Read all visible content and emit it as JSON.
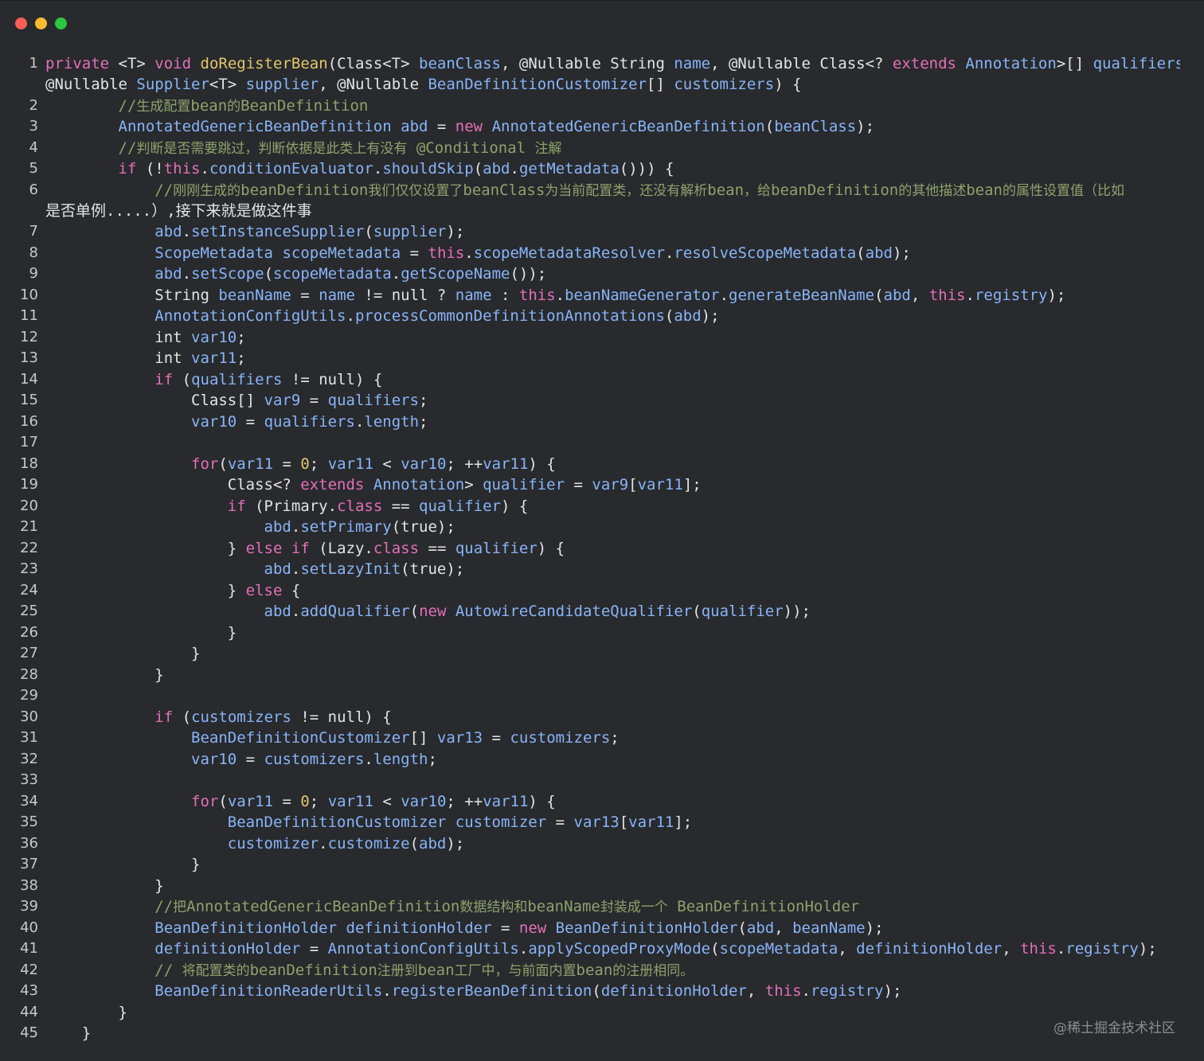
{
  "window": {
    "buttons": [
      {
        "name": "close",
        "color": "#fe5f57"
      },
      {
        "name": "minimize",
        "color": "#febc2e"
      },
      {
        "name": "zoom",
        "color": "#28c840"
      }
    ]
  },
  "watermark": "@稀土掘金技术社区",
  "colors": {
    "background": "#282a2d",
    "keyword": "#e46fb9",
    "function": "#e2c76b",
    "identifier": "#89b4f8",
    "comment": "#8fa26c",
    "plain": "#e4e4e4"
  },
  "code": {
    "lines": [
      {
        "n": "1",
        "text": "private <T> void doRegisterBean(Class<T> beanClass, @Nullable String name, @Nullable Class<? extends Annotation>[] qualifiers,",
        "cont": "@Nullable Supplier<T> supplier, @Nullable BeanDefinitionCustomizer[] customizers) {"
      },
      {
        "n": "2",
        "text": "        //生成配置bean的BeanDefinition"
      },
      {
        "n": "3",
        "text": "        AnnotatedGenericBeanDefinition abd = new AnnotatedGenericBeanDefinition(beanClass);"
      },
      {
        "n": "4",
        "text": "        //判断是否需要跳过，判断依据是此类上有没有 @Conditional 注解"
      },
      {
        "n": "5",
        "text": "        if (!this.conditionEvaluator.shouldSkip(abd.getMetadata())) {"
      },
      {
        "n": "6",
        "text": "            //刚刚生成的beanDefinition我们仅仅设置了beanClass为当前配置类，还没有解析bean，给beanDefinition的其他描述bean的属性设置值（比如",
        "cont": "是否单例.....）,接下来就是做这件事"
      },
      {
        "n": "7",
        "text": "            abd.setInstanceSupplier(supplier);"
      },
      {
        "n": "8",
        "text": "            ScopeMetadata scopeMetadata = this.scopeMetadataResolver.resolveScopeMetadata(abd);"
      },
      {
        "n": "9",
        "text": "            abd.setScope(scopeMetadata.getScopeName());"
      },
      {
        "n": "10",
        "text": "            String beanName = name != null ? name : this.beanNameGenerator.generateBeanName(abd, this.registry);"
      },
      {
        "n": "11",
        "text": "            AnnotationConfigUtils.processCommonDefinitionAnnotations(abd);"
      },
      {
        "n": "12",
        "text": "            int var10;"
      },
      {
        "n": "13",
        "text": "            int var11;"
      },
      {
        "n": "14",
        "text": "            if (qualifiers != null) {"
      },
      {
        "n": "15",
        "text": "                Class[] var9 = qualifiers;"
      },
      {
        "n": "16",
        "text": "                var10 = qualifiers.length;"
      },
      {
        "n": "17",
        "text": ""
      },
      {
        "n": "18",
        "text": "                for(var11 = 0; var11 < var10; ++var11) {"
      },
      {
        "n": "19",
        "text": "                    Class<? extends Annotation> qualifier = var9[var11];"
      },
      {
        "n": "20",
        "text": "                    if (Primary.class == qualifier) {"
      },
      {
        "n": "21",
        "text": "                        abd.setPrimary(true);"
      },
      {
        "n": "22",
        "text": "                    } else if (Lazy.class == qualifier) {"
      },
      {
        "n": "23",
        "text": "                        abd.setLazyInit(true);"
      },
      {
        "n": "24",
        "text": "                    } else {"
      },
      {
        "n": "25",
        "text": "                        abd.addQualifier(new AutowireCandidateQualifier(qualifier));"
      },
      {
        "n": "26",
        "text": "                    }"
      },
      {
        "n": "27",
        "text": "                }"
      },
      {
        "n": "28",
        "text": "            }"
      },
      {
        "n": "29",
        "text": ""
      },
      {
        "n": "30",
        "text": "            if (customizers != null) {"
      },
      {
        "n": "31",
        "text": "                BeanDefinitionCustomizer[] var13 = customizers;"
      },
      {
        "n": "32",
        "text": "                var10 = customizers.length;"
      },
      {
        "n": "33",
        "text": ""
      },
      {
        "n": "34",
        "text": "                for(var11 = 0; var11 < var10; ++var11) {"
      },
      {
        "n": "35",
        "text": "                    BeanDefinitionCustomizer customizer = var13[var11];"
      },
      {
        "n": "36",
        "text": "                    customizer.customize(abd);"
      },
      {
        "n": "37",
        "text": "                }"
      },
      {
        "n": "38",
        "text": "            }"
      },
      {
        "n": "39",
        "text": "            //把AnnotatedGenericBeanDefinition数据结构和beanName封装成一个 BeanDefinitionHolder"
      },
      {
        "n": "40",
        "text": "            BeanDefinitionHolder definitionHolder = new BeanDefinitionHolder(abd, beanName);"
      },
      {
        "n": "41",
        "text": "            definitionHolder = AnnotationConfigUtils.applyScopedProxyMode(scopeMetadata, definitionHolder, this.registry);"
      },
      {
        "n": "42",
        "text": "            // 将配置类的beanDefinition注册到bean工厂中，与前面内置bean的注册相同。"
      },
      {
        "n": "43",
        "text": "            BeanDefinitionReaderUtils.registerBeanDefinition(definitionHolder, this.registry);"
      },
      {
        "n": "44",
        "text": "        }"
      },
      {
        "n": "45",
        "text": "    }"
      }
    ]
  }
}
